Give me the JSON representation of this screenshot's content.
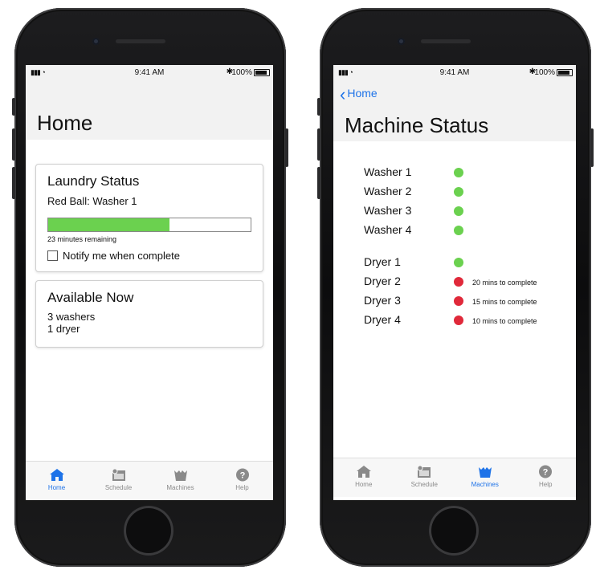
{
  "status_bar": {
    "time": "9:41 AM",
    "battery": "100%"
  },
  "home": {
    "title": "Home",
    "laundry_card": {
      "title": "Laundry Status",
      "machine_line": "Red Ball: Washer 1",
      "progress_fraction": 0.6,
      "remaining": "23 minutes remaining",
      "notify_label": "Notify me when complete",
      "notify_checked": false
    },
    "available_card": {
      "title": "Available Now",
      "line1": "3 washers",
      "line2": "1 dryer"
    }
  },
  "machines": {
    "back_label": "Home",
    "title": "Machine Status",
    "washers": [
      {
        "name": "Washer 1",
        "status": "available",
        "note": ""
      },
      {
        "name": "Washer 2",
        "status": "available",
        "note": ""
      },
      {
        "name": "Washer 3",
        "status": "available",
        "note": ""
      },
      {
        "name": "Washer 4",
        "status": "available",
        "note": ""
      }
    ],
    "dryers": [
      {
        "name": "Dryer 1",
        "status": "available",
        "note": ""
      },
      {
        "name": "Dryer 2",
        "status": "busy",
        "note": "20 mins to complete"
      },
      {
        "name": "Dryer 3",
        "status": "busy",
        "note": "15 mins to complete"
      },
      {
        "name": "Dryer 4",
        "status": "busy",
        "note": "10 mins to complete"
      }
    ]
  },
  "tabs": [
    {
      "label": "Home",
      "icon": "home-icon"
    },
    {
      "label": "Schedule",
      "icon": "calendar-icon"
    },
    {
      "label": "Machines",
      "icon": "washtub-icon"
    },
    {
      "label": "Help",
      "icon": "help-icon"
    }
  ],
  "colors": {
    "accent": "#1e73e8",
    "available": "#6bd14f",
    "busy": "#e0293a",
    "progress": "#6bd14f"
  }
}
